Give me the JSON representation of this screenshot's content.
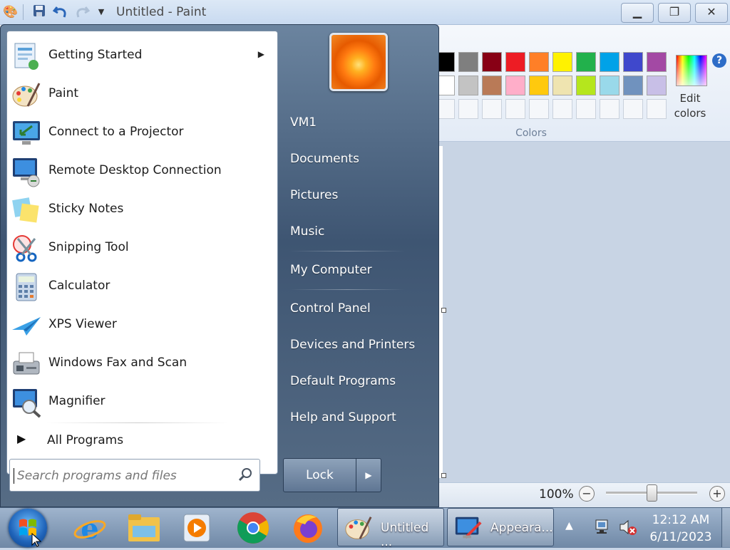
{
  "paint": {
    "title": "Untitled - Paint",
    "colors_group": "Colors",
    "edit_colors": "Edit colors",
    "zoom": "100%",
    "palette_row1": [
      "#000000",
      "#7f7f7f",
      "#880015",
      "#ed1c24",
      "#ff7f27",
      "#fff200",
      "#22b14c",
      "#00a2e8",
      "#3f48cc",
      "#a349a4"
    ],
    "palette_row2": [
      "#ffffff",
      "#c3c3c3",
      "#b97a57",
      "#ffaec9",
      "#ffc90e",
      "#efe4b0",
      "#b5e61d",
      "#99d9ea",
      "#7092be",
      "#c8bfe7"
    ]
  },
  "start_menu": {
    "programs": [
      {
        "label": "Getting Started",
        "icon": "getting-started-icon"
      },
      {
        "label": "Paint",
        "icon": "paint-icon"
      },
      {
        "label": "Connect to a Projector",
        "icon": "projector-icon"
      },
      {
        "label": "Remote Desktop Connection",
        "icon": "remote-desktop-icon"
      },
      {
        "label": "Sticky Notes",
        "icon": "sticky-notes-icon"
      },
      {
        "label": "Snipping Tool",
        "icon": "snipping-tool-icon"
      },
      {
        "label": "Calculator",
        "icon": "calculator-icon"
      },
      {
        "label": "XPS Viewer",
        "icon": "xps-viewer-icon"
      },
      {
        "label": "Windows Fax and Scan",
        "icon": "fax-scan-icon"
      },
      {
        "label": "Magnifier",
        "icon": "magnifier-icon"
      }
    ],
    "all_programs": "All Programs",
    "search_placeholder": "Search programs and files",
    "places": [
      "VM1",
      "Documents",
      "Pictures",
      "Music",
      "My Computer",
      "Control Panel",
      "Devices and Printers",
      "Default Programs",
      "Help and Support"
    ],
    "lock": "Lock"
  },
  "taskbar": {
    "tasks": [
      "Untitled ...",
      "Appeara..."
    ],
    "time": "12:12 AM",
    "date": "6/11/2023"
  }
}
